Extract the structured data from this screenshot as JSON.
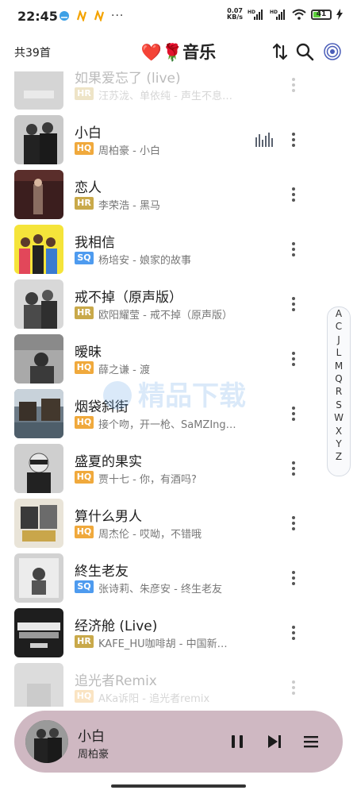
{
  "status_bar": {
    "time": "22:45",
    "notification_dots": "···",
    "net_speed_value": "0.07",
    "net_speed_unit": "KB/s",
    "battery": "41"
  },
  "header": {
    "count_label": "共39首",
    "title_heart": "❤️",
    "title_rose": "🌹",
    "title_text": "音乐",
    "sort_icon": "sort-updown-icon",
    "search_icon": "search-icon",
    "target_icon": "target-icon"
  },
  "songs": [
    {
      "name": "如果爱忘了 (live)",
      "quality": "HR",
      "meta": "汪苏泷、单依纯 - 声生不息…"
    },
    {
      "name": "小白",
      "quality": "HQ",
      "meta": "周柏豪 - 小白",
      "playing": true
    },
    {
      "name": "恋人",
      "quality": "HR",
      "meta": "李荣浩 - 黑马"
    },
    {
      "name": "我相信",
      "quality": "SQ",
      "meta": "杨培安 - 娘家的故事"
    },
    {
      "name": "戒不掉（原声版）",
      "quality": "HR",
      "meta": "欧阳耀莹 - 戒不掉（原声版）"
    },
    {
      "name": "暧昧",
      "quality": "HQ",
      "meta": "薛之谦 - 渡"
    },
    {
      "name": "烟袋斜街",
      "quality": "HQ",
      "meta": "接个吻，开一枪、SaMZIng…"
    },
    {
      "name": "盛夏的果实",
      "quality": "HQ",
      "meta": "贾十七 - 你，有酒吗?"
    },
    {
      "name": "算什么男人",
      "quality": "HQ",
      "meta": "周杰伦 - 哎呦，不错哦"
    },
    {
      "name": "終生老友",
      "quality": "SQ",
      "meta": "张诗莉、朱彦安 - 终生老友"
    },
    {
      "name": "经济舱 (Live)",
      "quality": "HR",
      "meta": "KAFE_HU咖啡胡 - 中国新…"
    },
    {
      "name": "追光者Remix",
      "quality": "HQ",
      "meta": "AKa诉阳 - 追光者remix"
    }
  ],
  "quality_colors": {
    "HR": "#c9a94a",
    "HQ": "#f0a93c",
    "SQ": "#4e9bef"
  },
  "alphabet_index": [
    "A",
    "C",
    "J",
    "L",
    "M",
    "Q",
    "R",
    "S",
    "W",
    "X",
    "Y",
    "Z"
  ],
  "watermark": "精品下载",
  "player": {
    "title": "小白",
    "artist": "周柏豪",
    "pause_icon": "pause-icon",
    "next_icon": "next-track-icon",
    "queue_icon": "playlist-menu-icon"
  }
}
